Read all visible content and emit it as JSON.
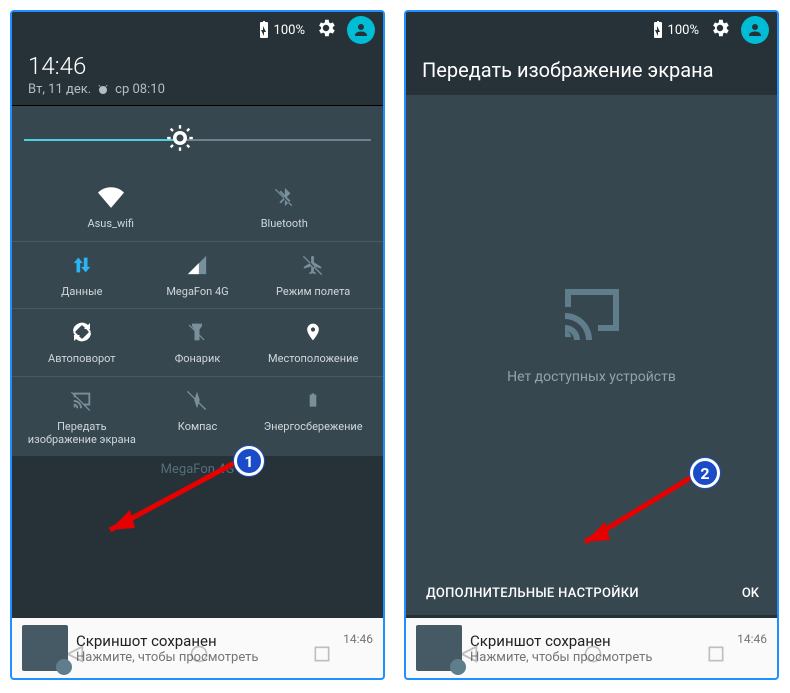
{
  "status": {
    "battery_pct": "100%"
  },
  "left": {
    "time": "14:46",
    "date": "Вт, 11 дек.",
    "alarm": "ср 08:10",
    "tiles": {
      "wifi": "Asus_wifi",
      "bt": "Bluetooth",
      "data": "Данные",
      "signal": "MegaFon 4G",
      "airplane": "Режим полета",
      "autorotate": "Автоповорот",
      "flashlight": "Фонарик",
      "location": "Местоположение",
      "cast": "Передать изображение экрана",
      "compass": "Компас",
      "battery": "Энергосбережение"
    },
    "carrier_ghost": "MegaFon 4G"
  },
  "right": {
    "title": "Передать изображение экрана",
    "empty_msg": "Нет доступных устройств",
    "advanced": "ДОПОЛНИТЕЛЬНЫЕ НАСТРОЙКИ",
    "ok": "OK"
  },
  "notif": {
    "title": "Скриншот сохранен",
    "sub": "Нажмите, чтобы просмотреть",
    "time": "14:46"
  },
  "badges": {
    "one": "1",
    "two": "2"
  }
}
